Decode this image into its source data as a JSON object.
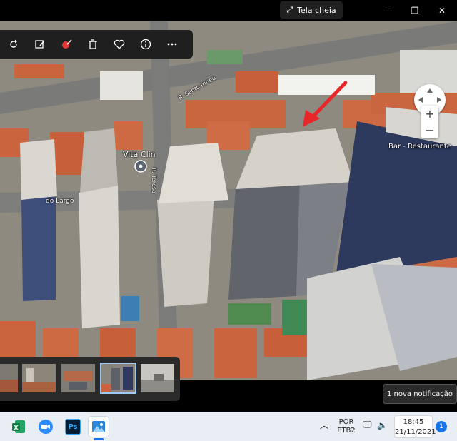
{
  "titlebar": {
    "fullscreen_label": "Tela cheia",
    "minimize_icon": "minimize-icon",
    "restore_icon": "restore-icon",
    "close_icon": "close-icon"
  },
  "toolbar": {
    "icons": [
      "rotate-icon",
      "edit-image-icon",
      "remove-spot-icon",
      "delete-icon",
      "favorite-heart-icon",
      "info-icon",
      "more-options-icon"
    ]
  },
  "map": {
    "labels": {
      "place": "Vita Clin",
      "street_largo": "do Largo",
      "street_santo": "R. Santo Irineu",
      "street_teresa": "R. Teresa",
      "bar": "Bar - Restaurante"
    }
  },
  "filmstrip": {
    "count": 5,
    "selected_index": 3
  },
  "notification": {
    "text": "1 nova notificação"
  },
  "taskbar": {
    "apps": [
      "excel-icon",
      "zoom-icon",
      "photoshop-icon",
      "photos-icon"
    ],
    "ps_label": "Ps",
    "language_line1": "POR",
    "language_line2": "PTB2",
    "time": "18:45",
    "date": "21/11/2021",
    "notification_count": "1"
  },
  "colors": {
    "arrow": "#e8262a",
    "taskbar_bg": "#e9eef5",
    "selected_thumb_border": "#9ec9f2"
  }
}
